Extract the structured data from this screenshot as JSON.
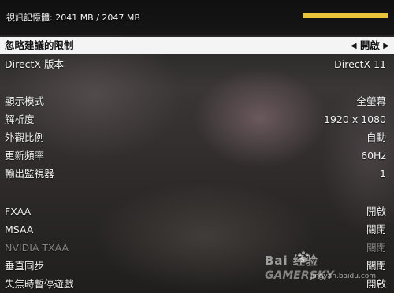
{
  "memory": {
    "label": "視訊記憶體: 2041 MB / 2047 MB",
    "fraction": 0.997,
    "bar_color": "#e9c43a"
  },
  "settings": [
    {
      "id": "ignore-limits",
      "label": "忽略建議的限制",
      "value": "開啟",
      "selected": true,
      "disabled": false
    },
    {
      "id": "directx-version",
      "label": "DirectX 版本",
      "value": "DirectX 11",
      "selected": false,
      "disabled": false
    },
    {
      "id": "display-mode",
      "label": "顯示模式",
      "value": "全螢幕",
      "selected": false,
      "disabled": false
    },
    {
      "id": "resolution",
      "label": "解析度",
      "value": "1920 x 1080",
      "selected": false,
      "disabled": false
    },
    {
      "id": "aspect-ratio",
      "label": "外觀比例",
      "value": "自動",
      "selected": false,
      "disabled": false
    },
    {
      "id": "refresh-rate",
      "label": "更新頻率",
      "value": "60Hz",
      "selected": false,
      "disabled": false
    },
    {
      "id": "output-monitor",
      "label": "輸出監視器",
      "value": "1",
      "selected": false,
      "disabled": false
    },
    {
      "id": "fxaa",
      "label": "FXAA",
      "value": "開啟",
      "selected": false,
      "disabled": false
    },
    {
      "id": "msaa",
      "label": "MSAA",
      "value": "關閉",
      "selected": false,
      "disabled": false
    },
    {
      "id": "nvidia-txaa",
      "label": "NVIDIA TXAA",
      "value": "關閉",
      "selected": false,
      "disabled": true
    },
    {
      "id": "vsync",
      "label": "垂直同步",
      "value": "關閉",
      "selected": false,
      "disabled": false
    },
    {
      "id": "pause-on-focus-loss",
      "label": "失焦時暫停遊戲",
      "value": "開啟",
      "selected": false,
      "disabled": false
    }
  ],
  "arrows": {
    "left": "◀",
    "right": "▶"
  },
  "watermark": {
    "logo": "Bai 经验",
    "sub": "GAMERSKY",
    "url": "jingyan.baidu.com"
  }
}
